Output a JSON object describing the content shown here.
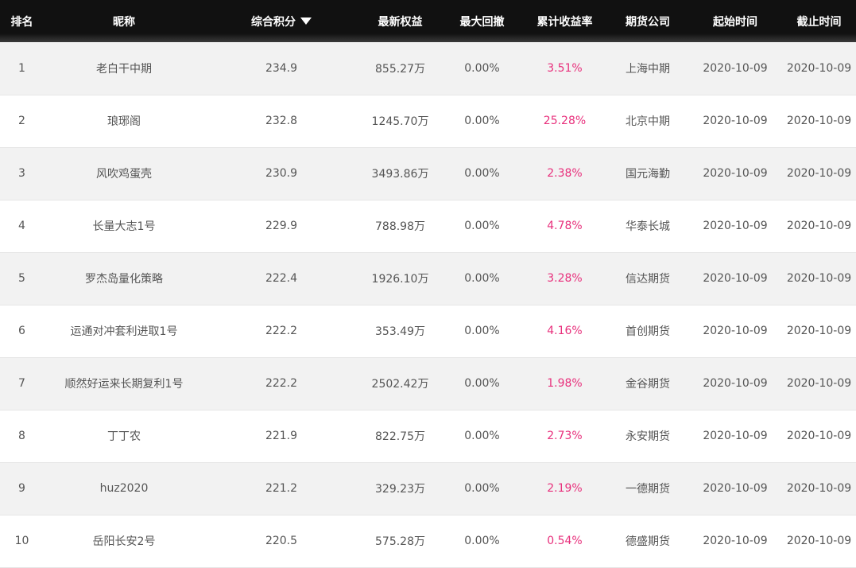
{
  "table": {
    "headers": {
      "rank": "排名",
      "nickname": "昵称",
      "score": "综合积分",
      "equity": "最新权益",
      "drawdown": "最大回撤",
      "return": "累计收益率",
      "company": "期货公司",
      "start": "起始时间",
      "end": "截止时间"
    },
    "sort_column": "score",
    "sort_direction": "descending",
    "rows": [
      {
        "rank": "1",
        "nickname": "老白干中期",
        "score": "234.9",
        "equity": "855.27万",
        "drawdown": "0.00%",
        "return": "3.51%",
        "company": "上海中期",
        "start": "2020-10-09",
        "end": "2020-10-09"
      },
      {
        "rank": "2",
        "nickname": "琅琊阁",
        "score": "232.8",
        "equity": "1245.70万",
        "drawdown": "0.00%",
        "return": "25.28%",
        "company": "北京中期",
        "start": "2020-10-09",
        "end": "2020-10-09"
      },
      {
        "rank": "3",
        "nickname": "风吹鸡蛋壳",
        "score": "230.9",
        "equity": "3493.86万",
        "drawdown": "0.00%",
        "return": "2.38%",
        "company": "国元海勤",
        "start": "2020-10-09",
        "end": "2020-10-09"
      },
      {
        "rank": "4",
        "nickname": "长量大志1号",
        "score": "229.9",
        "equity": "788.98万",
        "drawdown": "0.00%",
        "return": "4.78%",
        "company": "华泰长城",
        "start": "2020-10-09",
        "end": "2020-10-09"
      },
      {
        "rank": "5",
        "nickname": "罗杰岛量化策略",
        "score": "222.4",
        "equity": "1926.10万",
        "drawdown": "0.00%",
        "return": "3.28%",
        "company": "信达期货",
        "start": "2020-10-09",
        "end": "2020-10-09"
      },
      {
        "rank": "6",
        "nickname": "运通对冲套利进取1号",
        "score": "222.2",
        "equity": "353.49万",
        "drawdown": "0.00%",
        "return": "4.16%",
        "company": "首创期货",
        "start": "2020-10-09",
        "end": "2020-10-09"
      },
      {
        "rank": "7",
        "nickname": "顺然好运来长期复利1号",
        "score": "222.2",
        "equity": "2502.42万",
        "drawdown": "0.00%",
        "return": "1.98%",
        "company": "金谷期货",
        "start": "2020-10-09",
        "end": "2020-10-09"
      },
      {
        "rank": "8",
        "nickname": "丁丁农",
        "score": "221.9",
        "equity": "822.75万",
        "drawdown": "0.00%",
        "return": "2.73%",
        "company": "永安期货",
        "start": "2020-10-09",
        "end": "2020-10-09"
      },
      {
        "rank": "9",
        "nickname": "huz2020",
        "score": "221.2",
        "equity": "329.23万",
        "drawdown": "0.00%",
        "return": "2.19%",
        "company": "一德期货",
        "start": "2020-10-09",
        "end": "2020-10-09"
      },
      {
        "rank": "10",
        "nickname": "岳阳长安2号",
        "score": "220.5",
        "equity": "575.28万",
        "drawdown": "0.00%",
        "return": "0.54%",
        "company": "德盛期货",
        "start": "2020-10-09",
        "end": "2020-10-09"
      }
    ]
  },
  "colors": {
    "header_bg": "#111111",
    "header_text": "#ffffff",
    "row_odd_bg": "#f2f2f2",
    "row_even_bg": "#ffffff",
    "body_text": "#555555",
    "return_text": "#e8307c"
  },
  "icons": {
    "sort": "caret-down-icon"
  }
}
